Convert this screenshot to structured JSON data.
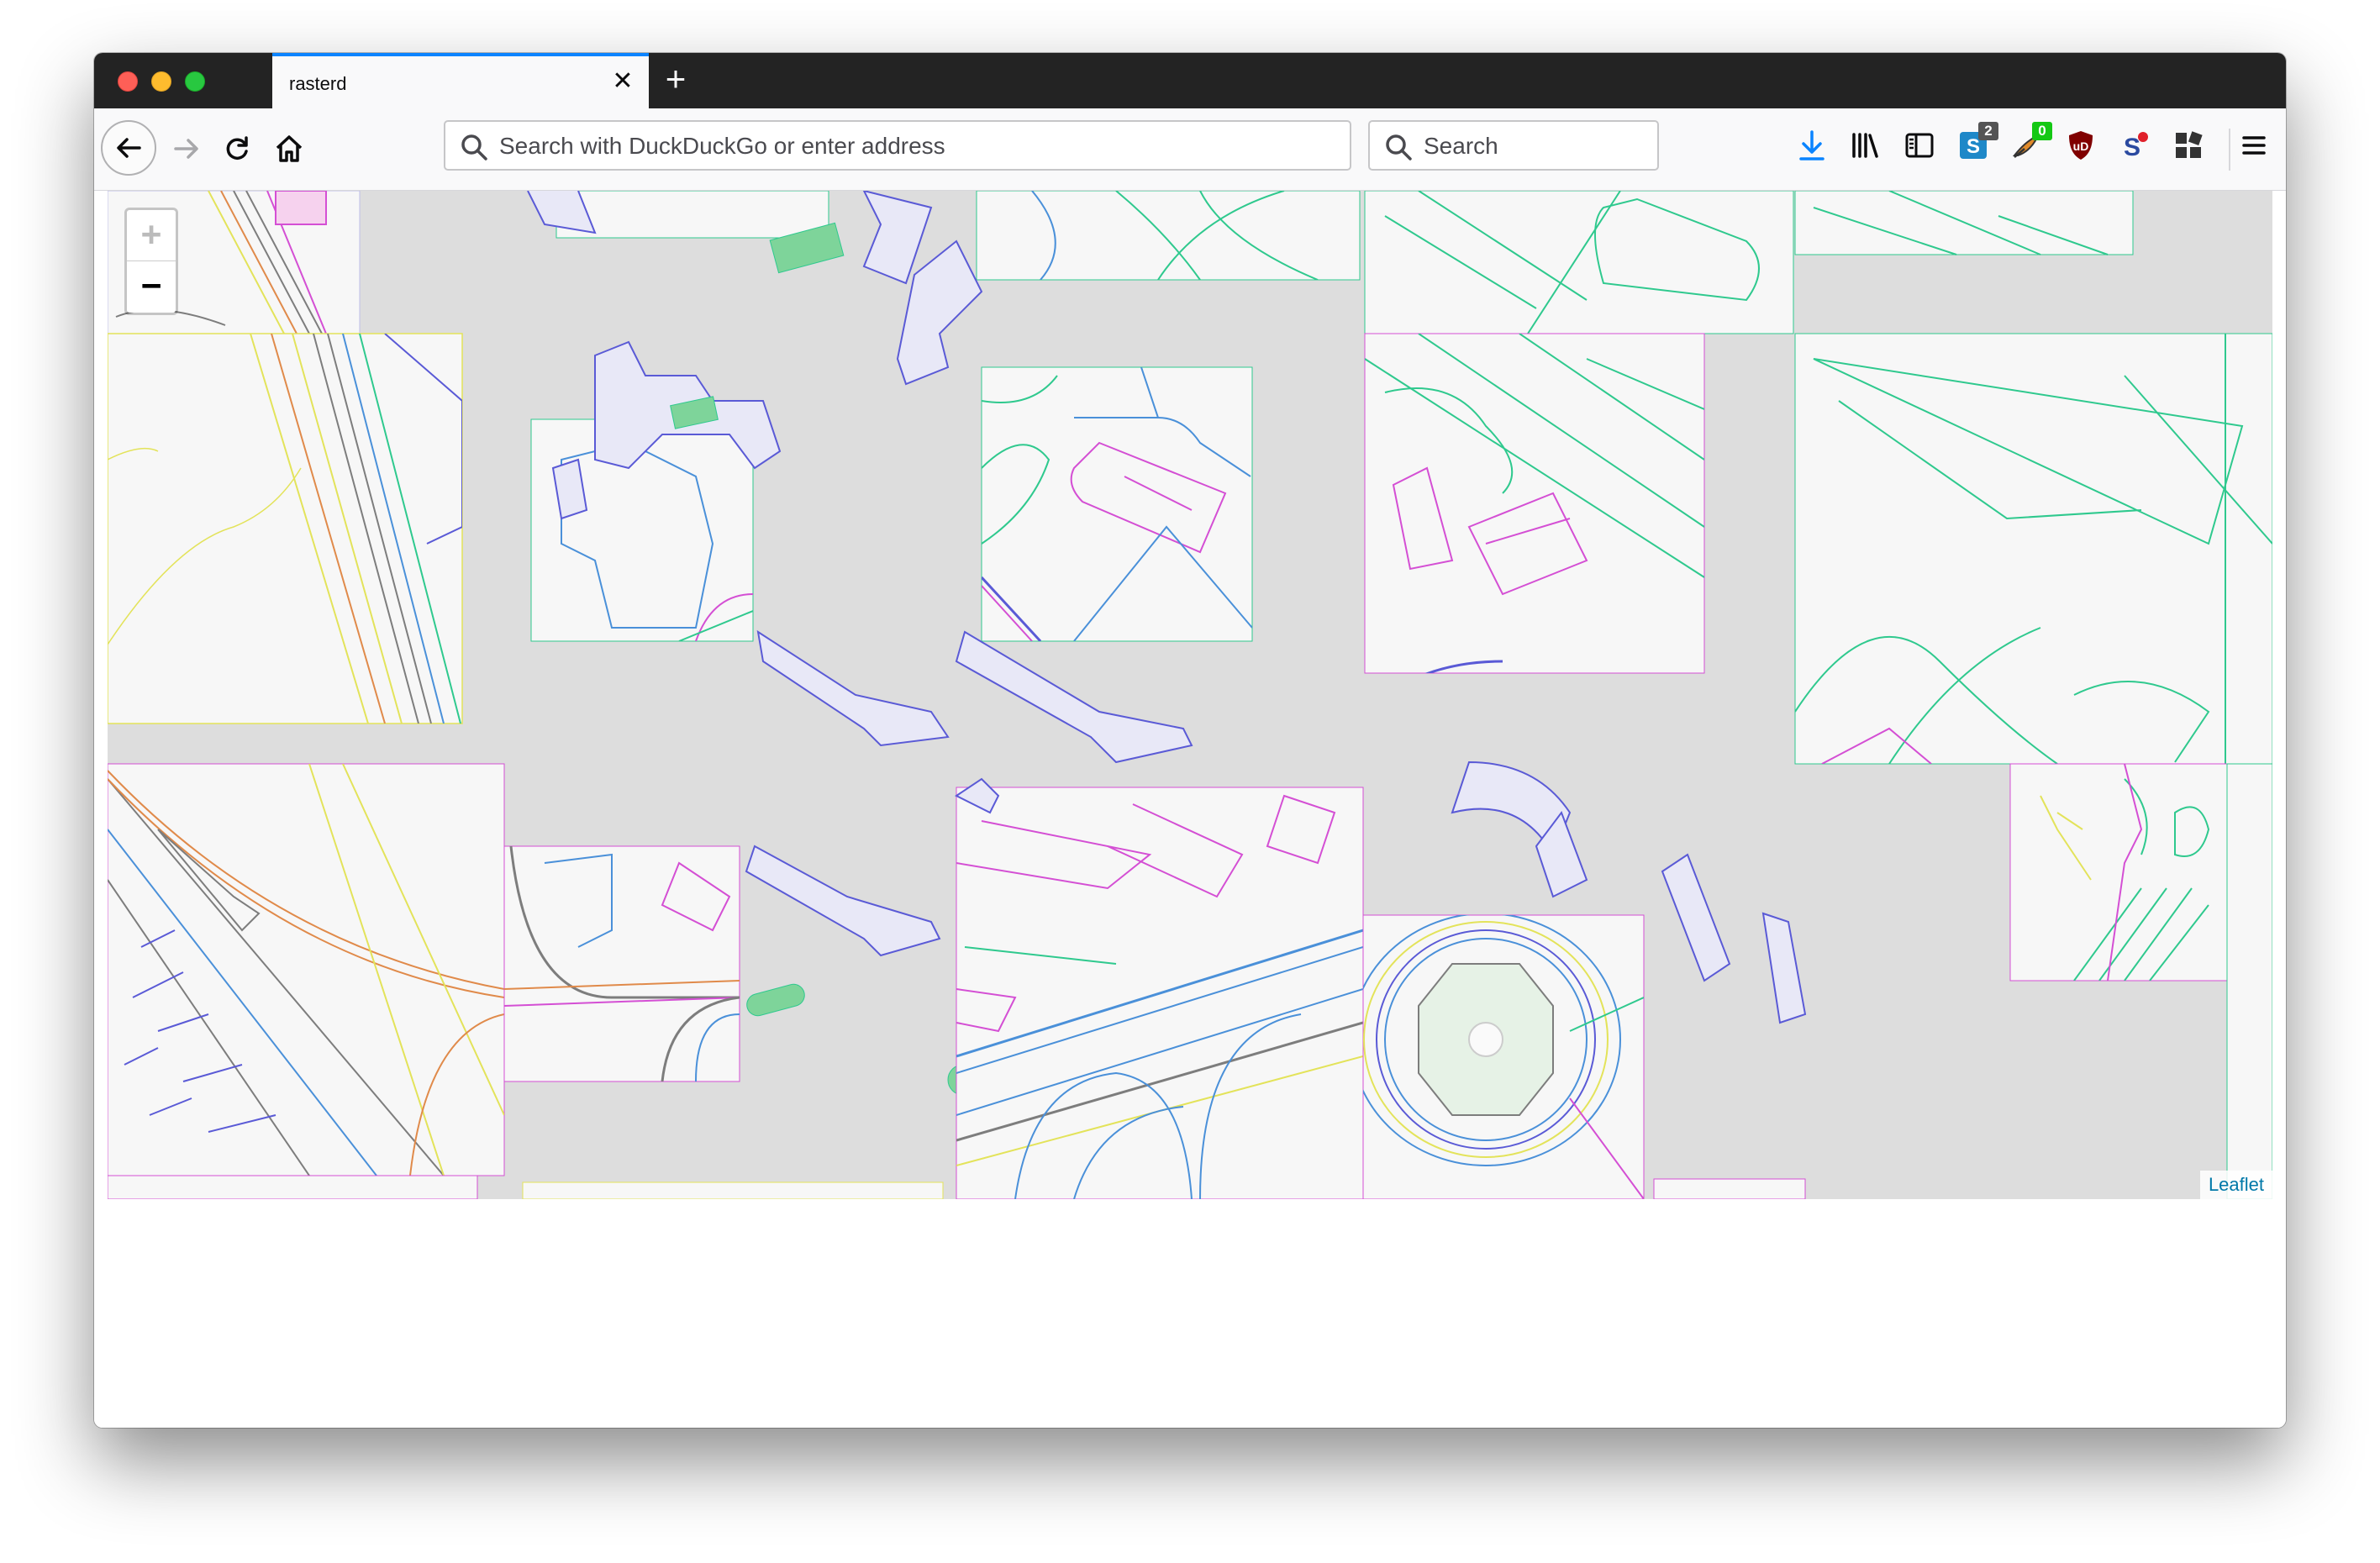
{
  "browser": {
    "tab": {
      "title": "rasterd",
      "close_glyph": "✕"
    },
    "new_tab_glyph": "+",
    "url_bar": {
      "placeholder": "Search with DuckDuckGo or enter address",
      "value": ""
    },
    "search_bar": {
      "placeholder": "Search",
      "value": ""
    },
    "toolbar_icons": [
      "download-icon",
      "library-icon",
      "sidebar-icon",
      "extension-s-icon",
      "extension-feather-icon",
      "ublock-icon",
      "extension-s-red-icon",
      "extensions-grid-icon",
      "menu-icon"
    ],
    "badges": {
      "extension_s": "2",
      "extension_feather": "0"
    },
    "accent_color": "#0a84ff"
  },
  "map": {
    "zoom_in_label": "+",
    "zoom_out_label": "−",
    "zoom_in_disabled": true,
    "attribution": "Leaflet",
    "background_color": "#dddddd",
    "line_colors": [
      "#5a5ad6",
      "#2fc98e",
      "#d44fd4",
      "#4a90d9",
      "#e3e35a",
      "#e08a4a",
      "#7d7d7d"
    ]
  }
}
